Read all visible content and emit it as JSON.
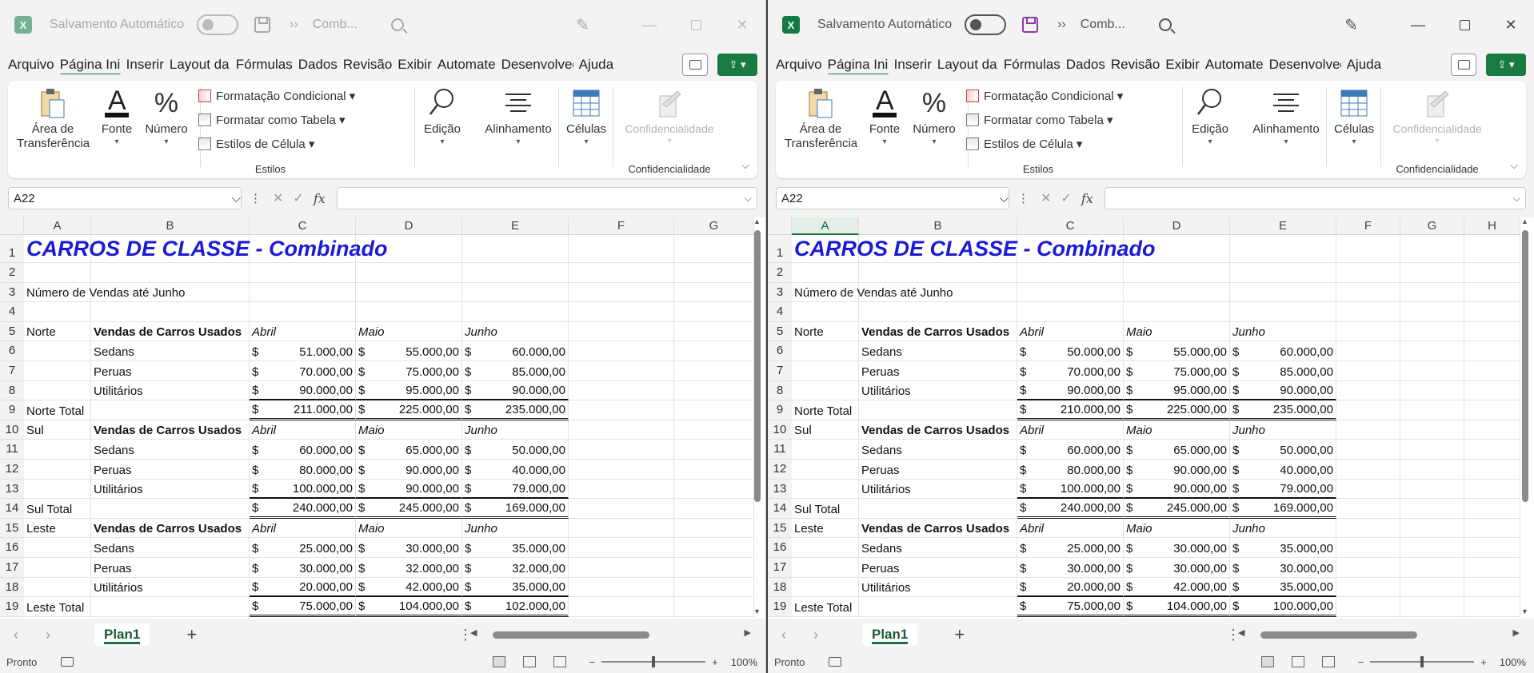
{
  "app": {
    "autosave_label": "Salvamento Automático",
    "title": "Comb...",
    "tb_chevrons": "››"
  },
  "menu": {
    "tabs": [
      "Arquivo",
      "Página Inicial",
      "Inserir",
      "Layout da Página",
      "Fórmulas",
      "Dados",
      "Revisão",
      "Exibir",
      "Automate",
      "Desenvolvedor",
      "Ajuda"
    ]
  },
  "ribbon": {
    "clipboard": "Área de Transferência",
    "font": "Fonte",
    "number": "Número",
    "cond_format": "Formatação Condicional",
    "format_table": "Formatar como Tabela",
    "cell_styles": "Estilos de Célula",
    "styles_group": "Estilos",
    "edit": "Edição",
    "align": "Alinhamento",
    "cells": "Células",
    "conf": "Confidencialidade",
    "conf_group": "Confidencialidade"
  },
  "formula_bar": {
    "name_box": "A22",
    "fx": "fx",
    "formula": ""
  },
  "sheet": {
    "tab": "Plan1",
    "status": "Pronto",
    "zoom": "100%"
  },
  "colors": {
    "excel_green": "#107c41",
    "title_blue": "#1b1bd6"
  },
  "left": {
    "columns": [
      "A",
      "B",
      "C",
      "D",
      "E",
      "F",
      "G"
    ],
    "title": "CARROS DE CLASSE - Combinado",
    "subtitle": "Número de Vendas até Junho",
    "cells": {
      "r6": [
        "51.000,00",
        "55.000,00",
        "60.000,00"
      ],
      "r7": [
        "70.000,00",
        "75.000,00",
        "85.000,00"
      ],
      "r8": [
        "90.000,00",
        "95.000,00",
        "90.000,00"
      ],
      "r9": [
        "211.000,00",
        "225.000,00",
        "235.000,00"
      ],
      "r11": [
        "60.000,00",
        "65.000,00",
        "50.000,00"
      ],
      "r12": [
        "80.000,00",
        "90.000,00",
        "40.000,00"
      ],
      "r13": [
        "100.000,00",
        "90.000,00",
        "79.000,00"
      ],
      "r14": [
        "240.000,00",
        "245.000,00",
        "169.000,00"
      ],
      "r16": [
        "25.000,00",
        "30.000,00",
        "35.000,00"
      ],
      "r17": [
        "30.000,00",
        "32.000,00",
        "32.000,00"
      ],
      "r18": [
        "20.000,00",
        "42.000,00",
        "35.000,00"
      ],
      "r19": [
        "75.000,00",
        "104.000,00",
        "102.000,00"
      ]
    }
  },
  "right": {
    "columns": [
      "A",
      "B",
      "C",
      "D",
      "E",
      "F",
      "G",
      "H"
    ],
    "title": "CARROS DE CLASSE - Combinado",
    "subtitle": "Número de Vendas até Junho",
    "cells": {
      "r6": [
        "50.000,00",
        "55.000,00",
        "60.000,00"
      ],
      "r7": [
        "70.000,00",
        "75.000,00",
        "85.000,00"
      ],
      "r8": [
        "90.000,00",
        "95.000,00",
        "90.000,00"
      ],
      "r9": [
        "210.000,00",
        "225.000,00",
        "235.000,00"
      ],
      "r11": [
        "60.000,00",
        "65.000,00",
        "50.000,00"
      ],
      "r12": [
        "80.000,00",
        "90.000,00",
        "40.000,00"
      ],
      "r13": [
        "100.000,00",
        "90.000,00",
        "79.000,00"
      ],
      "r14": [
        "240.000,00",
        "245.000,00",
        "169.000,00"
      ],
      "r16": [
        "25.000,00",
        "30.000,00",
        "35.000,00"
      ],
      "r17": [
        "30.000,00",
        "30.000,00",
        "30.000,00"
      ],
      "r18": [
        "20.000,00",
        "42.000,00",
        "35.000,00"
      ],
      "r19": [
        "75.000,00",
        "104.000,00",
        "100.000,00"
      ]
    }
  },
  "labels": {
    "north": "Norte",
    "south": "Sul",
    "east": "Leste",
    "header": "Vendas de Carros Usados",
    "april": "Abril",
    "may": "Maio",
    "june": "Junho",
    "sedans": "Sedans",
    "wagons": "Peruas",
    "suvs": "Utilitários",
    "north_total": "Norte Total",
    "south_total": "Sul Total",
    "east_total": "Leste Total",
    "currency": "$"
  }
}
